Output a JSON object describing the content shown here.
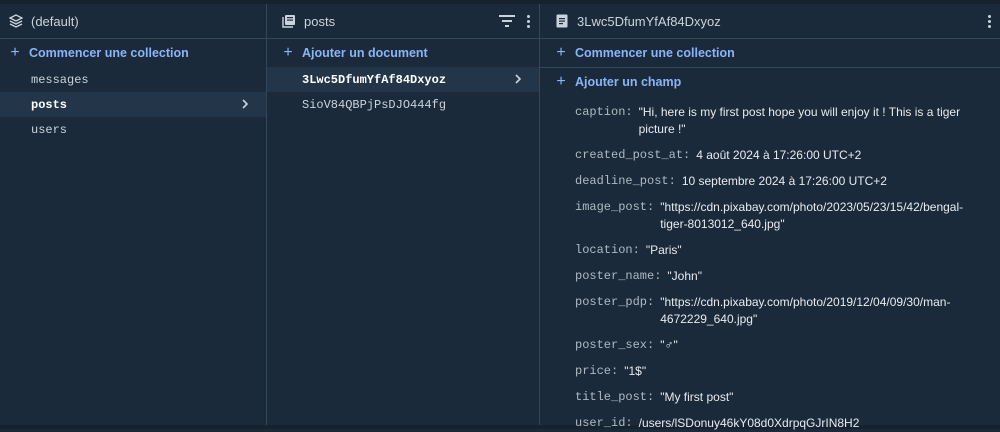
{
  "col1": {
    "title": "(default)",
    "add_label": "Commencer une collection",
    "items": [
      {
        "label": "messages"
      },
      {
        "label": "posts"
      },
      {
        "label": "users"
      }
    ]
  },
  "col2": {
    "title": "posts",
    "add_label": "Ajouter un document",
    "items": [
      {
        "label": "3Lwc5DfumYfAf84Dxyoz"
      },
      {
        "label": "SioV84QBPjPsDJO444fg"
      }
    ]
  },
  "col3": {
    "title": "3Lwc5DfumYfAf84Dxyoz",
    "add_collection_label": "Commencer une collection",
    "add_field_label": "Ajouter un champ",
    "fields": [
      {
        "key": "caption:",
        "value": "\"Hi, here is my first post hope you will enjoy it ! This is a tiger picture !\""
      },
      {
        "key": "created_post_at:",
        "value": "4 août 2024 à 17:26:00 UTC+2"
      },
      {
        "key": "deadline_post:",
        "value": "10 septembre 2024 à 17:26:00 UTC+2"
      },
      {
        "key": "image_post:",
        "value": "\"https://cdn.pixabay.com/photo/2023/05/23/15/42/bengal-tiger-8013012_640.jpg\""
      },
      {
        "key": "location:",
        "value": "\"Paris\""
      },
      {
        "key": "poster_name:",
        "value": "\"John\""
      },
      {
        "key": "poster_pdp:",
        "value": "\"https://cdn.pixabay.com/photo/2019/12/04/09/30/man-4672229_640.jpg\""
      },
      {
        "key": "poster_sex:",
        "value": "\"♂\""
      },
      {
        "key": "price:",
        "value": "\"1$\""
      },
      {
        "key": "title_post:",
        "value": "\"My first post\""
      },
      {
        "key": "user_id:",
        "value": "/users/lSDonuy46kY08d0XdrpqGJrIN8H2"
      }
    ]
  },
  "icons": {
    "db": "database-icon",
    "collection": "collection-icon",
    "document": "document-icon",
    "filter": "filter-icon",
    "more": "more-vert-icon",
    "chevron": "chevron-right-icon",
    "plus": "plus-icon"
  },
  "colors": {
    "accent": "#8ab4f8",
    "background": "#1b2a3a",
    "selected": "#233649"
  }
}
